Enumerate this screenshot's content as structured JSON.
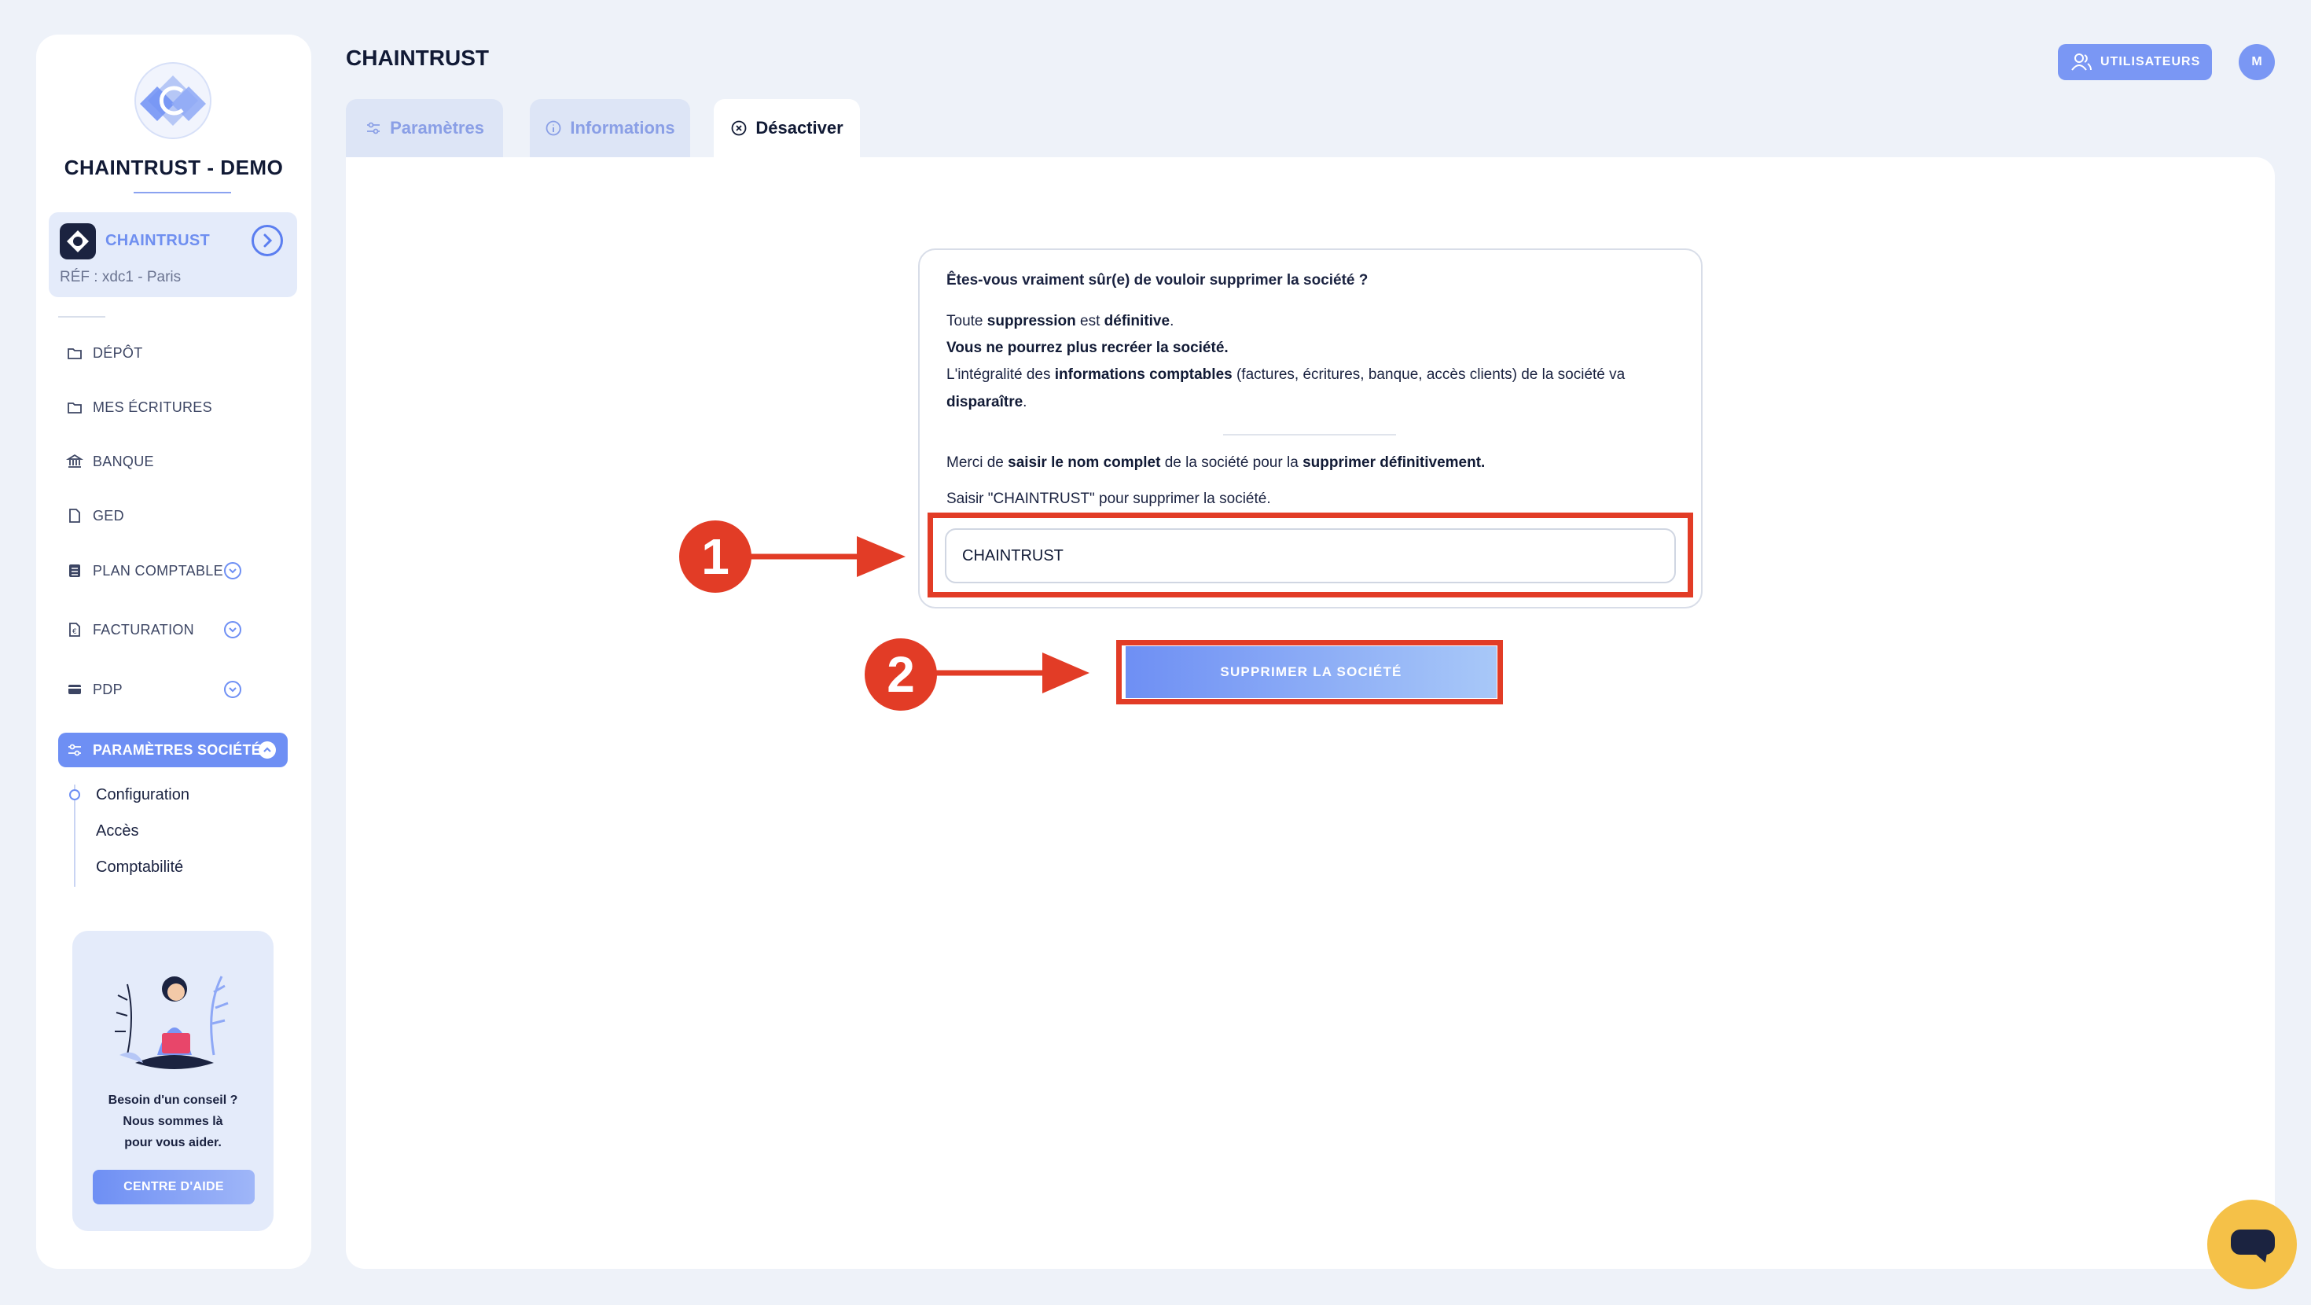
{
  "sidebar": {
    "company_name": "CHAINTRUST - DEMO",
    "company_card": {
      "name": "CHAINTRUST",
      "ref": "RÉF : xdc1 - Paris"
    },
    "nav": [
      {
        "label": "DÉPÔT",
        "icon": "folder-icon"
      },
      {
        "label": "MES ÉCRITURES",
        "icon": "folder-icon"
      },
      {
        "label": "BANQUE",
        "icon": "bank-icon"
      },
      {
        "label": "GED",
        "icon": "document-icon"
      },
      {
        "label": "PLAN COMPTABLE",
        "icon": "ledger-icon",
        "expandable": true
      },
      {
        "label": "FACTURATION",
        "icon": "invoice-icon",
        "expandable": true
      },
      {
        "label": "PDP",
        "icon": "card-icon",
        "expandable": true
      }
    ],
    "active_section": {
      "label": "PARAMÈTRES SOCIÉTÉ",
      "icon": "sliders-icon"
    },
    "sub_items": [
      "Configuration",
      "Accès",
      "Comptabilité"
    ],
    "help": {
      "line1": "Besoin d'un conseil ?",
      "line2": "Nous sommes là",
      "line3": "pour vous aider.",
      "button": "CENTRE D'AIDE"
    }
  },
  "header": {
    "title": "CHAINTRUST",
    "users_button": "UTILISATEURS",
    "avatar_initial": "M"
  },
  "tabs": [
    {
      "label": "Paramètres",
      "icon": "sliders-icon",
      "active": false
    },
    {
      "label": "Informations",
      "icon": "info-icon",
      "active": false
    },
    {
      "label": "Désactiver",
      "icon": "close-circle-icon",
      "active": true
    }
  ],
  "dialog": {
    "question": "Êtes-vous vraiment sûr(e) de vouloir supprimer la société ?",
    "p1_a": "Toute ",
    "p1_b": "suppression",
    "p1_c": " est ",
    "p1_d": "définitive",
    "p1_e": ".",
    "p2": "Vous ne pourrez plus recréer la société.",
    "p3_a": "L'intégralité des ",
    "p3_b": "informations comptables",
    "p3_c": " (factures, écritures, banque, accès clients) de la société va",
    "p4": "disparaître",
    "p4_e": ".",
    "p5_a": "Merci de ",
    "p5_b": "saisir le nom complet",
    "p5_c": " de la société pour la ",
    "p5_d": "supprimer définitivement.",
    "p6": "Saisir \"CHAINTRUST\" pour supprimer la société.",
    "input_value": "CHAINTRUST",
    "delete_button": "SUPPRIMER LA SOCIÉTÉ"
  },
  "annotations": {
    "step1": "1",
    "step2": "2",
    "color": "#e23c26"
  },
  "colors": {
    "accent": "#6e8ff4",
    "background": "#eef2f9",
    "chat": "#f5c148"
  }
}
